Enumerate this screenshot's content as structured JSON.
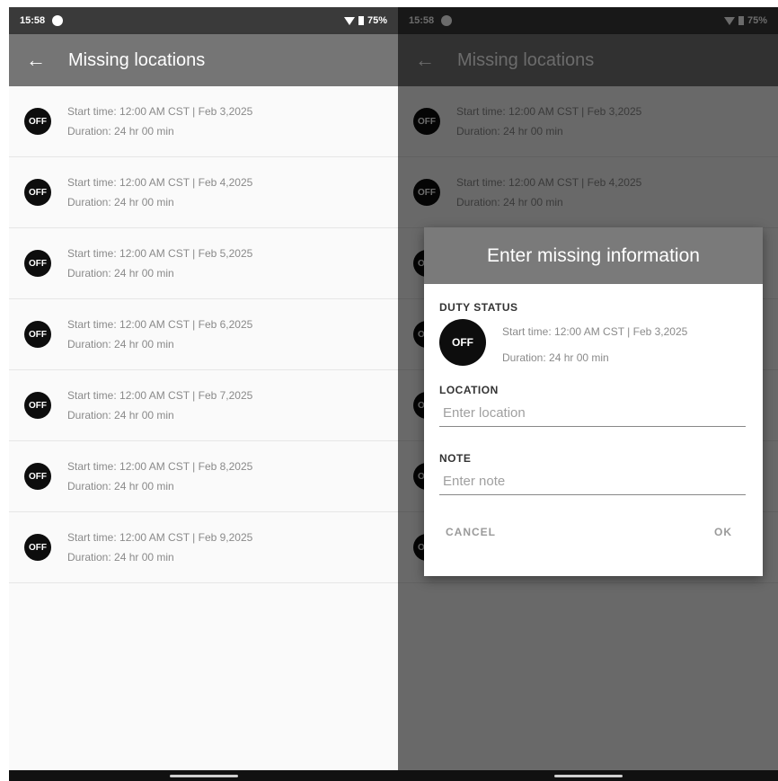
{
  "status_bar": {
    "time": "15:58",
    "battery": "75%"
  },
  "app_bar": {
    "back": "←",
    "title": "Missing locations"
  },
  "records": [
    {
      "badge": "OFF",
      "start": "Start time: 12:00 AM CST | Feb 3,2025",
      "duration": "Duration: 24 hr 00 min"
    },
    {
      "badge": "OFF",
      "start": "Start time: 12:00 AM CST | Feb 4,2025",
      "duration": "Duration: 24 hr 00 min"
    },
    {
      "badge": "OFF",
      "start": "Start time: 12:00 AM CST | Feb 5,2025",
      "duration": "Duration: 24 hr 00 min"
    },
    {
      "badge": "OFF",
      "start": "Start time: 12:00 AM CST | Feb 6,2025",
      "duration": "Duration: 24 hr 00 min"
    },
    {
      "badge": "OFF",
      "start": "Start time: 12:00 AM CST | Feb 7,2025",
      "duration": "Duration: 24 hr 00 min"
    },
    {
      "badge": "OFF",
      "start": "Start time: 12:00 AM CST | Feb 8,2025",
      "duration": "Duration: 24 hr 00 min"
    },
    {
      "badge": "OFF",
      "start": "Start time: 12:00 AM CST | Feb 9,2025",
      "duration": "Duration: 24 hr 00 min"
    }
  ],
  "dialog": {
    "title": "Enter missing information",
    "duty_status_label": "DUTY STATUS",
    "badge": "OFF",
    "start": "Start time: 12:00 AM CST | Feb 3,2025",
    "duration": "Duration: 24 hr 00 min",
    "location_label": "LOCATION",
    "location_placeholder": "Enter location",
    "location_value": "",
    "note_label": "NOTE",
    "note_placeholder": "Enter note",
    "note_value": "",
    "cancel": "CANCEL",
    "ok": "OK"
  },
  "colors": {
    "app_bar": "#757575",
    "status_bar": "#3a3a3a",
    "badge": "#0d0d0d",
    "scrim": "rgba(0,0,0,0.58)"
  },
  "icons": {
    "back": "arrow-left-icon",
    "status": "google-icon",
    "wifi": "wifi-icon",
    "battery": "battery-icon"
  }
}
